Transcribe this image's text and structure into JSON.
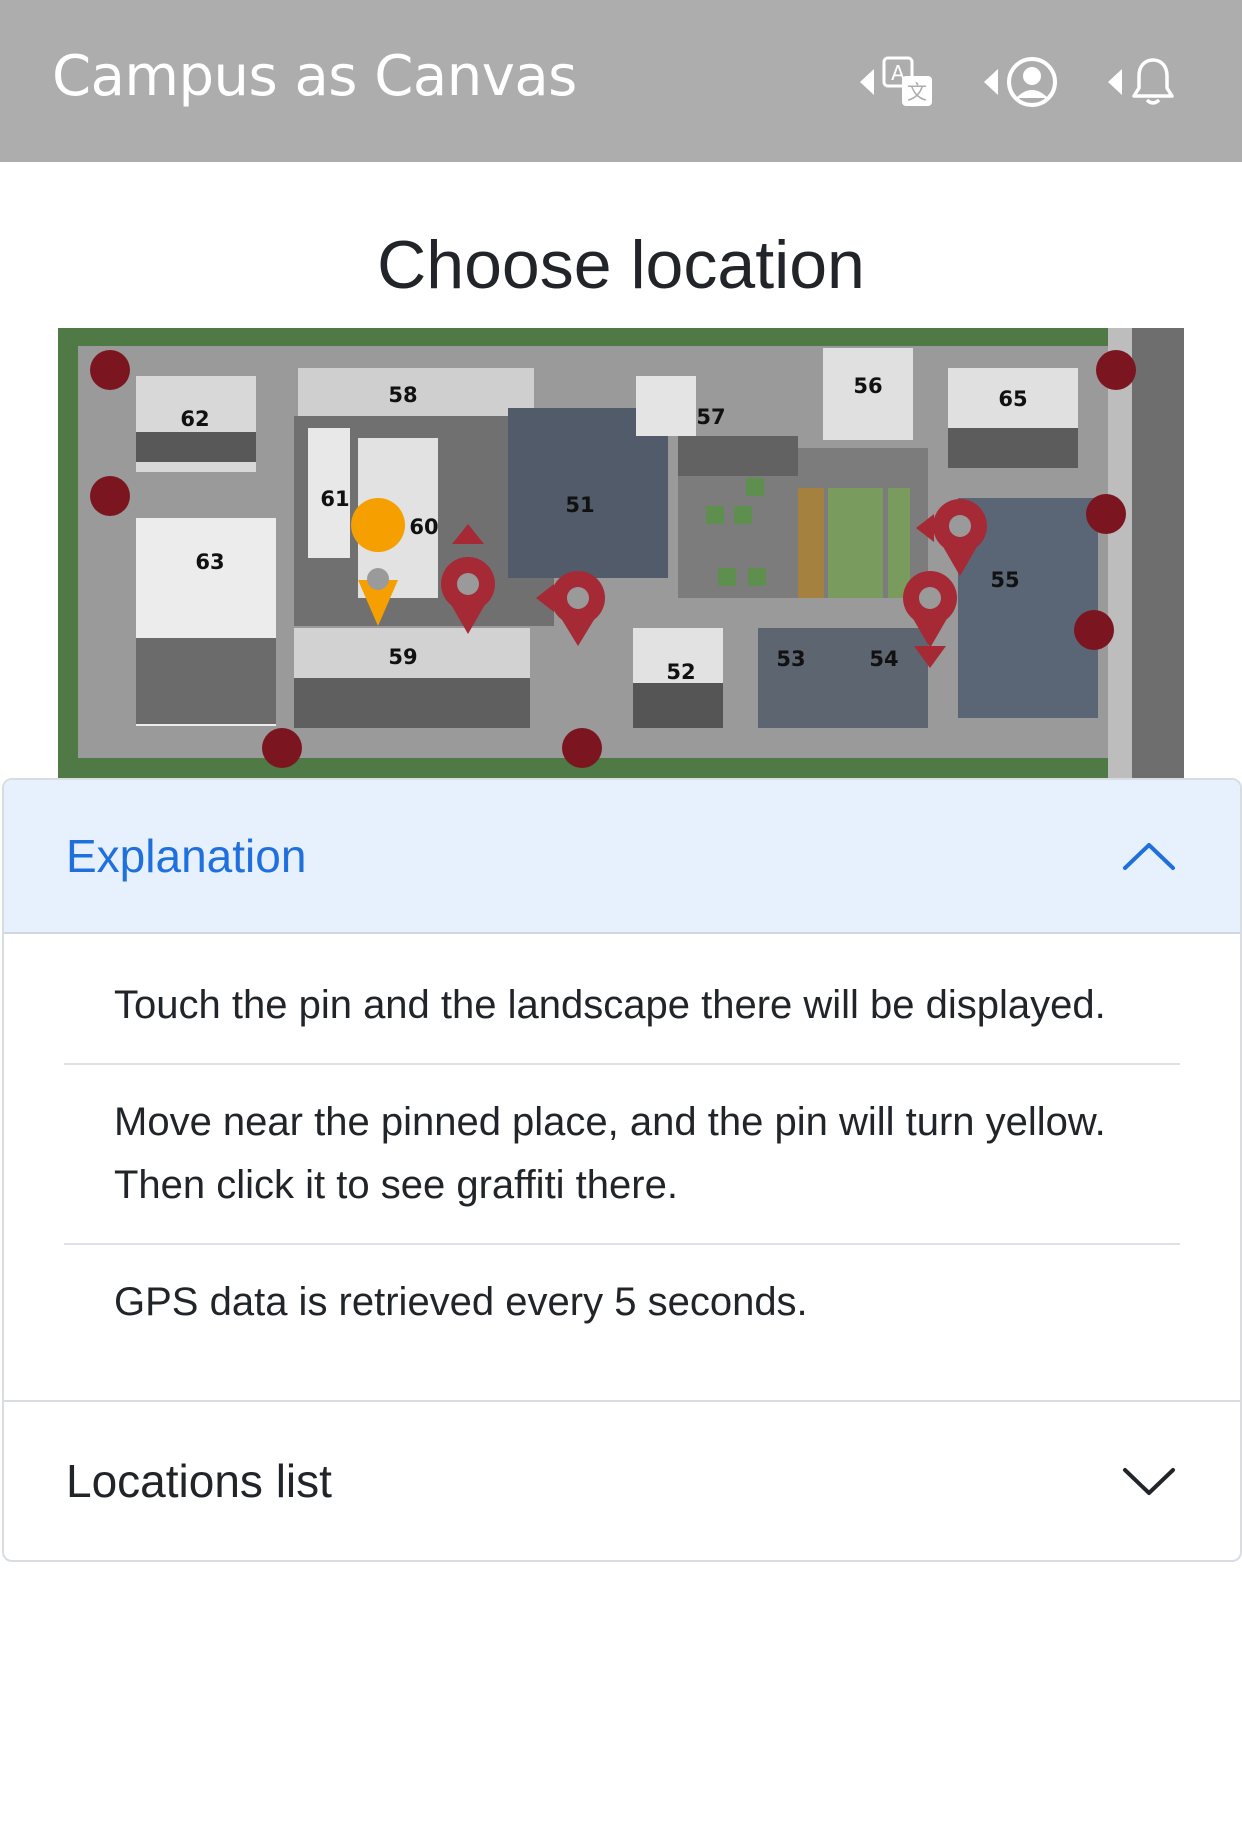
{
  "navbar": {
    "brand": "Campus as Canvas",
    "icons": [
      "translate-icon",
      "account-icon",
      "bell-icon"
    ],
    "background": "#adadad"
  },
  "page": {
    "title": "Choose location"
  },
  "map": {
    "building_numbers": [
      "58",
      "56",
      "65",
      "62",
      "57",
      "61",
      "60",
      "51",
      "63",
      "55",
      "59",
      "52",
      "53",
      "54"
    ],
    "pin_colors": {
      "current": "#f5a000",
      "default": "#a52a36"
    }
  },
  "accordion": {
    "explanation": {
      "label": "Explanation",
      "items": [
        "Touch the pin and the landscape there will be displayed.",
        "Move near the pinned place, and the pin will turn yellow. Then click it to see graffiti there.",
        "GPS data is retrieved every 5 seconds."
      ]
    },
    "locations": {
      "label": "Locations list"
    }
  }
}
